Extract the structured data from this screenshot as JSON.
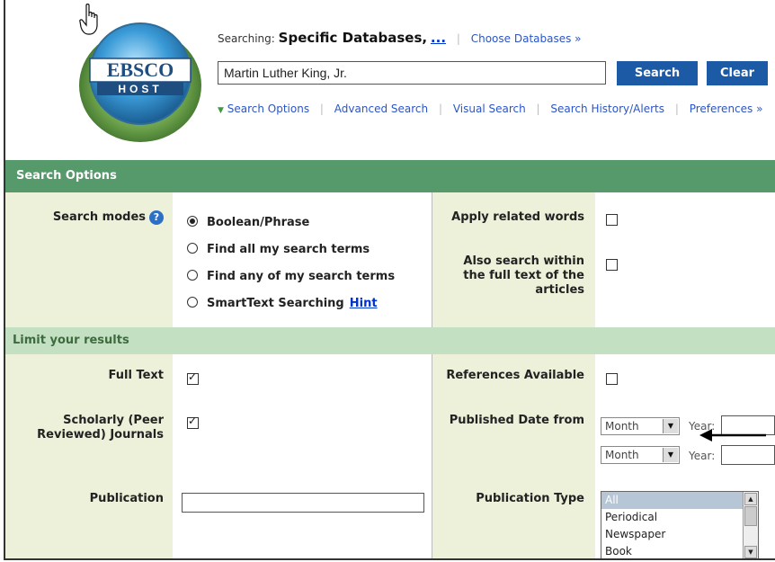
{
  "header": {
    "logo_text_top": "EBSCO",
    "logo_text_bottom": "HOST",
    "searching_label": "Searching:",
    "searching_value": "Specific Databases,",
    "searching_more": "...",
    "choose_databases": "Choose Databases »",
    "query_value": "Martin Luther King, Jr.",
    "search_button": "Search",
    "clear_button": "Clear",
    "links": {
      "search_options": "Search Options",
      "advanced_search": "Advanced Search",
      "visual_search": "Visual Search",
      "history": "Search History/Alerts",
      "preferences": "Preferences »"
    }
  },
  "search_options": {
    "title": "Search Options",
    "modes_label": "Search modes",
    "modes": [
      {
        "label": "Boolean/Phrase",
        "selected": true
      },
      {
        "label": "Find all my search terms",
        "selected": false
      },
      {
        "label": "Find any of my search terms",
        "selected": false
      },
      {
        "label": "SmartText Searching",
        "selected": false
      }
    ],
    "hint": "Hint",
    "apply_related": "Apply related words",
    "also_search": "Also search within the full text of the articles"
  },
  "limits": {
    "title": "Limit your results",
    "full_text": "Full Text",
    "scholarly": "Scholarly (Peer Reviewed) Journals",
    "publication": "Publication",
    "references": "References Available",
    "published_date": "Published Date from",
    "month": "Month",
    "year": "Year:",
    "publication_type": "Publication Type",
    "pub_types": [
      "All",
      "Periodical",
      "Newspaper",
      "Book"
    ]
  },
  "colors": {
    "dark_bar": "#56996a",
    "light_bar": "#c4e0c3",
    "label_column": "#eef1da",
    "button": "#1d5aa6",
    "link": "#2a55c8"
  }
}
